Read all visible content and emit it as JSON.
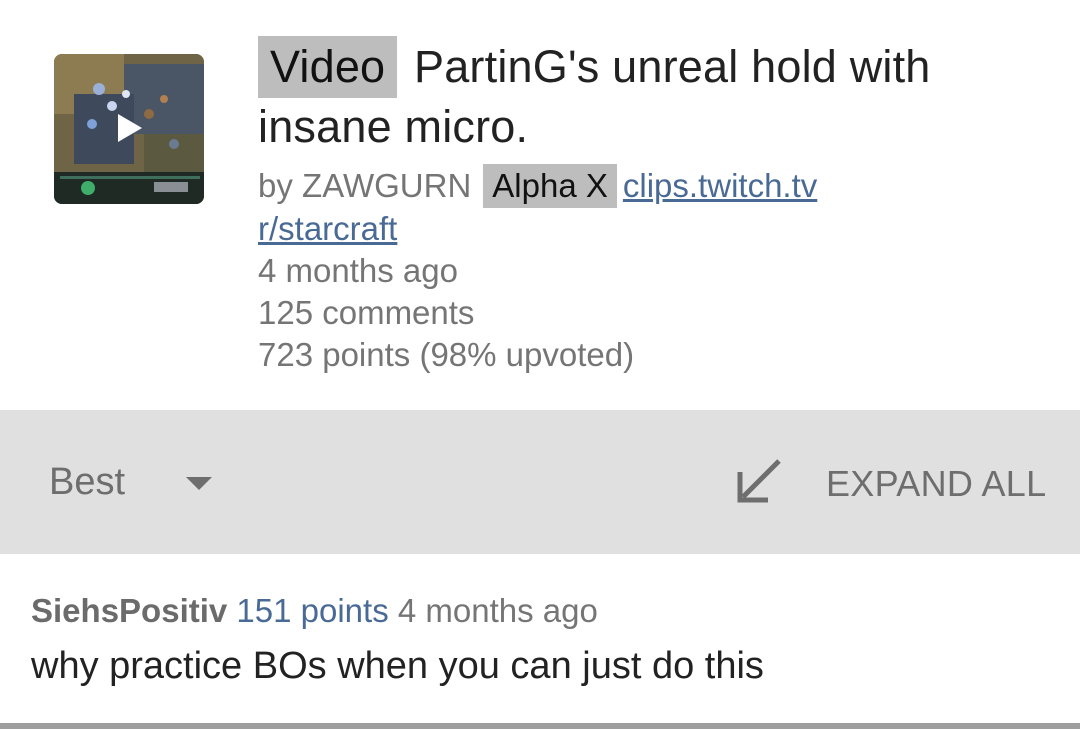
{
  "post": {
    "flair": "Video",
    "title": "PartinG's unreal hold with insane micro.",
    "author_prefix": "by",
    "author": "ZAWGURN",
    "author_flair": "Alpha X",
    "domain": "clips.twitch.tv",
    "subreddit": "r/starcraft",
    "age": "4 months ago",
    "comments": "125 comments",
    "score": "723 points (98% upvoted)",
    "thumbnail_icon": "play-icon"
  },
  "sortbar": {
    "sort_label": "Best",
    "sort_icon": "dropdown-caret-icon",
    "expand_icon": "arrow-down-left-icon",
    "expand_label": "EXPAND ALL"
  },
  "comment": {
    "author": "SiehsPositiv",
    "points": "151 points",
    "age": "4 months ago",
    "body": "why practice BOs when you can just do this"
  },
  "colors": {
    "link": "#4a6a96",
    "flair_bg": "#bdbdbd",
    "sortbar_bg": "#e0e0e0",
    "meta_text": "#757575"
  }
}
